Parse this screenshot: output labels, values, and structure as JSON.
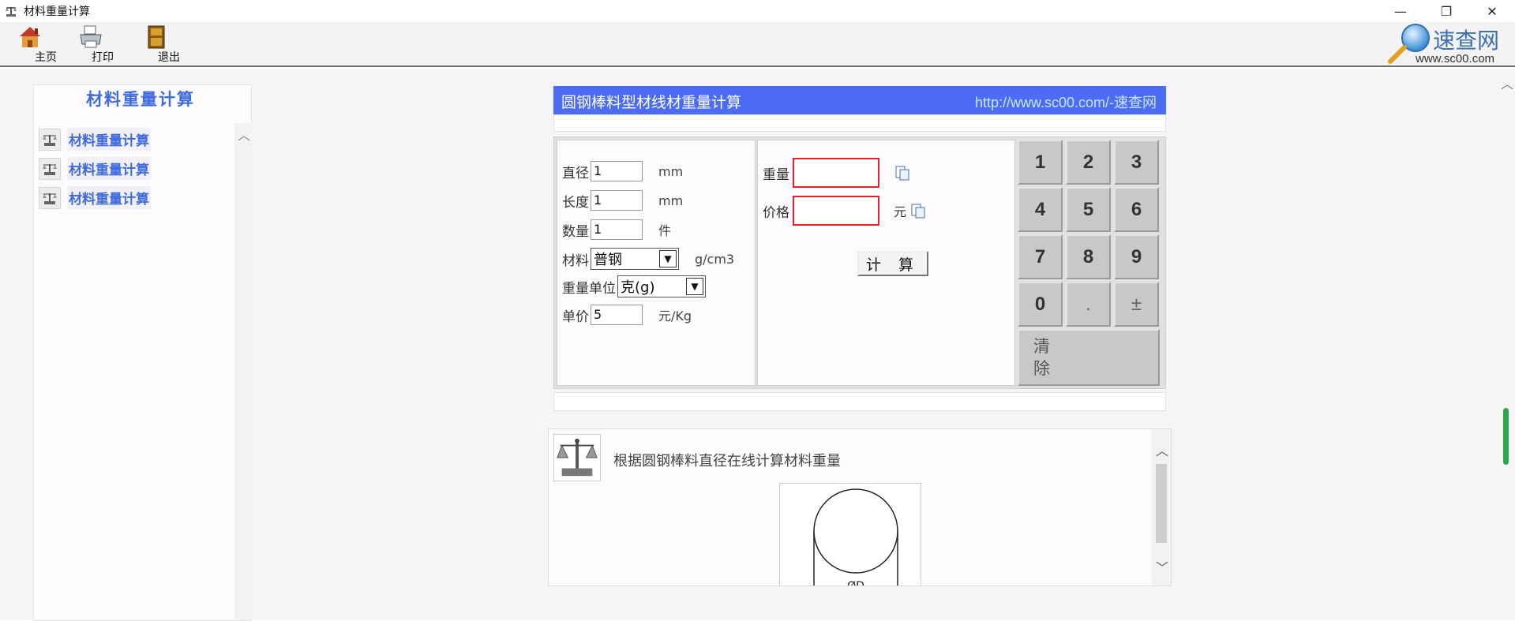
{
  "window": {
    "title": "材料重量计算",
    "controls": [
      "—",
      "❐",
      "✕"
    ]
  },
  "toolbar": {
    "home_label": "主页",
    "print_label": "打印",
    "exit_label": "退出"
  },
  "brand": {
    "name": "速查网",
    "url": "www.sc00.com"
  },
  "sidebar": {
    "title": "材料重量计算",
    "items": [
      {
        "label": "材料重量计算"
      },
      {
        "label": "材料重量计算"
      },
      {
        "label": "材料重量计算"
      }
    ]
  },
  "calculator": {
    "title": "圆钢棒料型材线材重量计算",
    "link": "http://www.sc00.com/-速查网",
    "fields": {
      "diameter": {
        "label": "直径",
        "value": "1",
        "unit": "mm"
      },
      "length": {
        "label": "长度",
        "value": "1",
        "unit": "mm"
      },
      "quantity": {
        "label": "数量",
        "value": "1",
        "unit": "件"
      },
      "material": {
        "label": "材料",
        "value": "普钢",
        "unit": "g/cm3"
      },
      "weight_unit": {
        "label": "重量单位",
        "value": "克(g)"
      },
      "unit_price": {
        "label": "单价",
        "value": "5",
        "unit": "元/Kg"
      }
    },
    "results": {
      "weight_label": "重量",
      "weight_value": "",
      "price_label": "价格",
      "price_value": "",
      "price_unit": "元"
    },
    "calc_button": "计 算",
    "keypad": {
      "row1": [
        "1",
        "2",
        "3"
      ],
      "row2": [
        "4",
        "5",
        "6"
      ],
      "row3": [
        "7",
        "8",
        "9"
      ],
      "row4": [
        "0",
        ".",
        "±"
      ],
      "clear": "清除"
    }
  },
  "description": {
    "text": "根据圆钢棒料直径在线计算材料重量",
    "figure_label": "ØD"
  },
  "colors": {
    "header_blue": "#4d6cf5",
    "link_blue": "#3f6be0",
    "result_border": "#e0262b",
    "scroll_green": "#2ea84f"
  }
}
